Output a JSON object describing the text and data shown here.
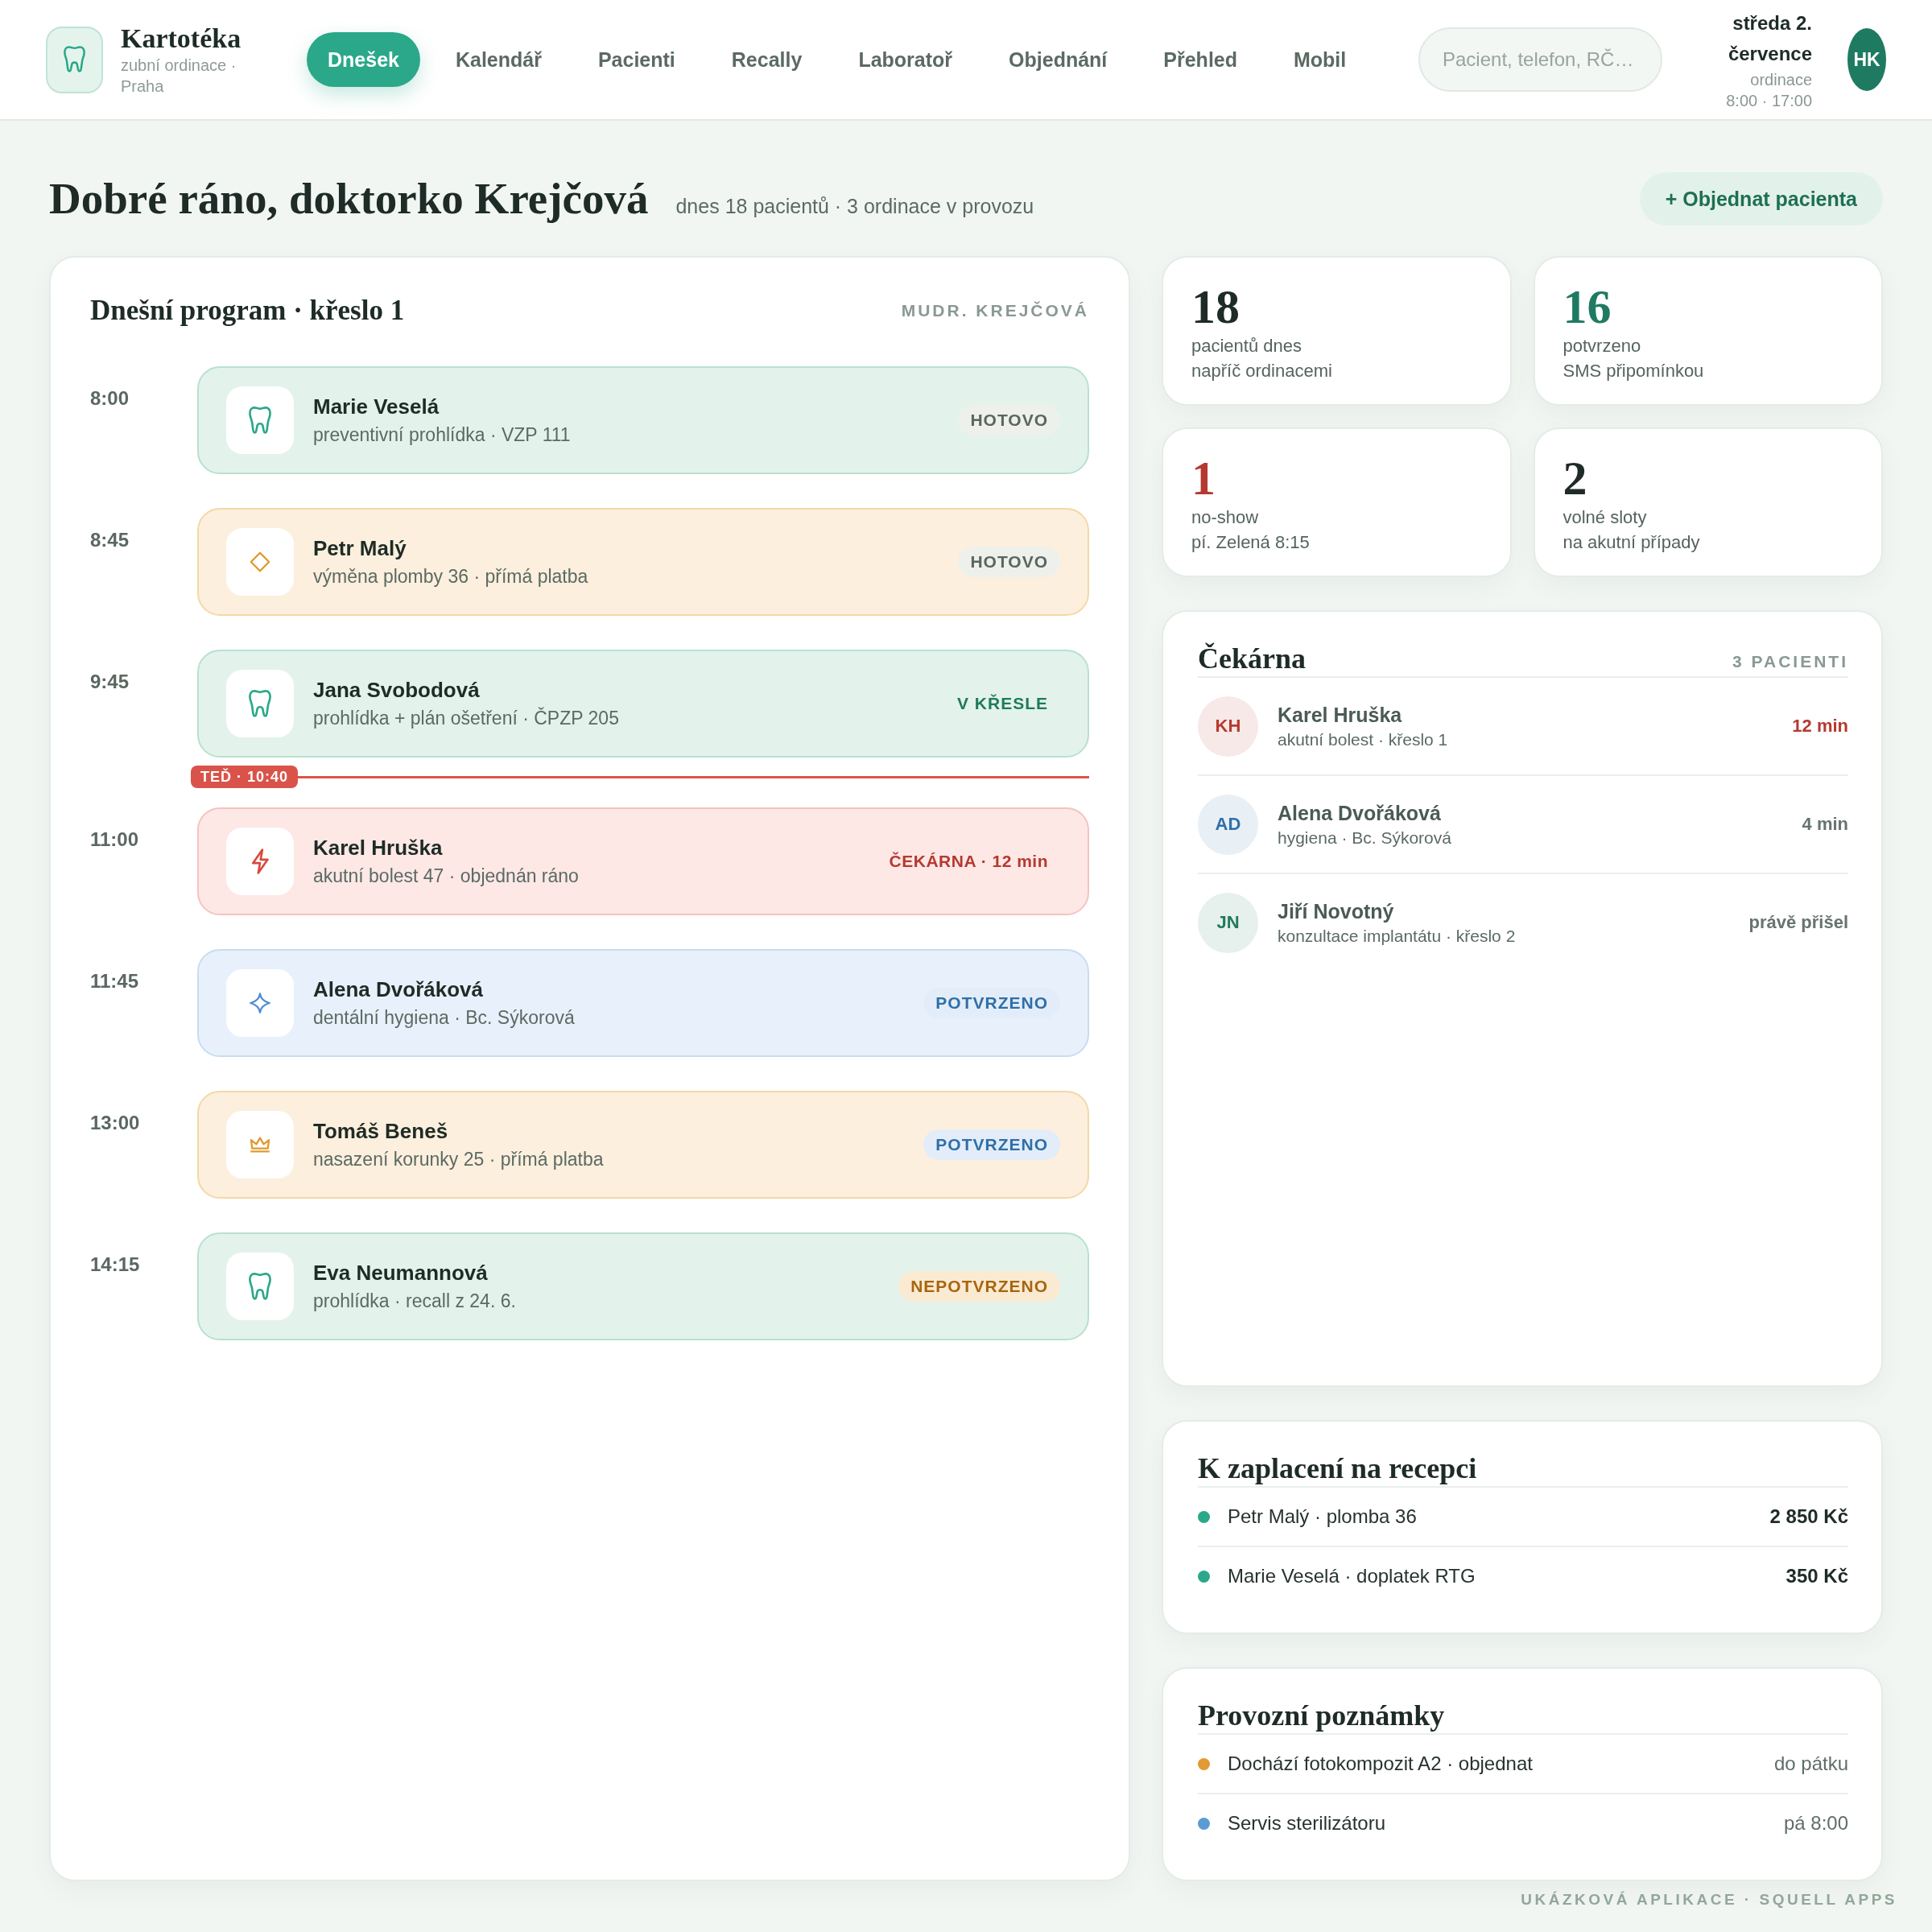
{
  "header": {
    "brand": {
      "title": "Kartotéka",
      "subtitle": "zubní ordinace · Praha"
    },
    "nav": [
      {
        "label": "Dnešek",
        "selected": true
      },
      {
        "label": "Kalendář",
        "selected": false
      },
      {
        "label": "Pacienti",
        "selected": false
      },
      {
        "label": "Recally",
        "selected": false
      },
      {
        "label": "Laboratoř",
        "selected": false
      },
      {
        "label": "Objednání",
        "selected": false
      },
      {
        "label": "Přehled",
        "selected": false
      },
      {
        "label": "Mobil",
        "selected": false
      }
    ],
    "search": {
      "placeholder": "Pacient, telefon, RČ…"
    },
    "date": {
      "day": "středa 2. července",
      "hours": "ordinace 8:00 · 17:00"
    },
    "avatar": {
      "initials": "HK"
    }
  },
  "greeting": {
    "title": "Dobré ráno, doktorko Krejčová",
    "summary": "dnes 18 pacientů · 3 ordinace v provozu",
    "action": "+ Objednat pacienta"
  },
  "schedule": {
    "title": "Dnešní program · křeslo 1",
    "doctor": "MUDR. KREJČOVÁ",
    "items": [
      {
        "kind": "checkup",
        "time": "8:00",
        "name": "Marie Veselá",
        "detail": "preventivní prohlídka · VZP 111",
        "status": {
          "kind": "done",
          "text": "HOTOVO"
        }
      },
      {
        "kind": "filling",
        "time": "8:45",
        "name": "Petr Malý",
        "detail": "výměna plomby 36 · přímá platba",
        "status": {
          "kind": "done",
          "text": "HOTOVO"
        }
      },
      {
        "kind": "checkup",
        "time": "9:45",
        "name": "Jana Svobodová",
        "detail": "prohlídka + plán ošetření · ČPZP 205",
        "status": {
          "kind": "in_chair",
          "text": "V KŘESLE"
        }
      },
      {
        "kind": "now",
        "label": "TEĎ · 10:40"
      },
      {
        "kind": "acute",
        "time": "11:00",
        "name": "Karel Hruška",
        "detail": "akutní bolest 47 · objednán ráno",
        "status": {
          "kind": "waiting",
          "text": "ČEKÁRNA · 12 min"
        }
      },
      {
        "kind": "hygiene",
        "time": "11:45",
        "name": "Alena Dvořáková",
        "detail": "dentální hygiena · Bc. Sýkorová",
        "status": {
          "kind": "confirmed",
          "text": "POTVRZENO"
        }
      },
      {
        "kind": "crown",
        "time": "13:00",
        "name": "Tomáš Beneš",
        "detail": "nasazení korunky 25 · přímá platba",
        "status": {
          "kind": "confirmed",
          "text": "POTVRZENO"
        }
      },
      {
        "kind": "checkup",
        "time": "14:15",
        "name": "Eva Neumannová",
        "detail": "prohlídka · recall z 24. 6.",
        "status": {
          "kind": "unconfirmed",
          "text": "NEPOTVRZENO"
        }
      }
    ]
  },
  "stats": [
    {
      "value": "18",
      "label": "pacientů dnes",
      "note": "napříč ordinacemi",
      "color": "#1e2b26"
    },
    {
      "value": "16",
      "label": "potvrzeno",
      "note": "SMS připomínkou",
      "color": "#1f7a62"
    },
    {
      "value": "1",
      "label": "no-show",
      "note": "pí. Zelená 8:15",
      "color": "#b5392f"
    },
    {
      "value": "2",
      "label": "volné sloty",
      "note": "na akutní případy",
      "color": "#1e2b26"
    }
  ],
  "waiting_room": {
    "title": "Čekárna",
    "count": "3 PACIENTI",
    "patients": [
      {
        "initials": "KH",
        "color": "#b5392f",
        "name": "Karel Hruška",
        "detail": "akutní bolest · křeslo 1",
        "wait": "12 min",
        "urgent": true
      },
      {
        "initials": "AD",
        "color": "#2f6fa8",
        "name": "Alena Dvořáková",
        "detail": "hygiena · Bc. Sýkorová",
        "wait": "4 min",
        "urgent": false
      },
      {
        "initials": "JN",
        "color": "#1f7a5c",
        "name": "Jiří Novotný",
        "detail": "konzultace implantátu · křeslo 2",
        "wait": "právě přišel",
        "urgent": false
      }
    ]
  },
  "payments": {
    "title": "K zaplacení na recepci",
    "items": [
      {
        "text": "Petr Malý · plomba 36",
        "amount": "2 850 Kč"
      },
      {
        "text": "Marie Veselá · doplatek RTG",
        "amount": "350 Kč"
      }
    ]
  },
  "notes": {
    "title": "Provozní poznámky",
    "items": [
      {
        "color": "#e39a33",
        "text": "Dochází fotokompozit A2 · objednat",
        "due": "do pátku"
      },
      {
        "color": "#5b9bd5",
        "text": "Servis sterilizátoru",
        "due": "pá 8:00"
      }
    ]
  },
  "footer": "UKÁZKOVÁ APLIKACE · SQUELL APPS"
}
